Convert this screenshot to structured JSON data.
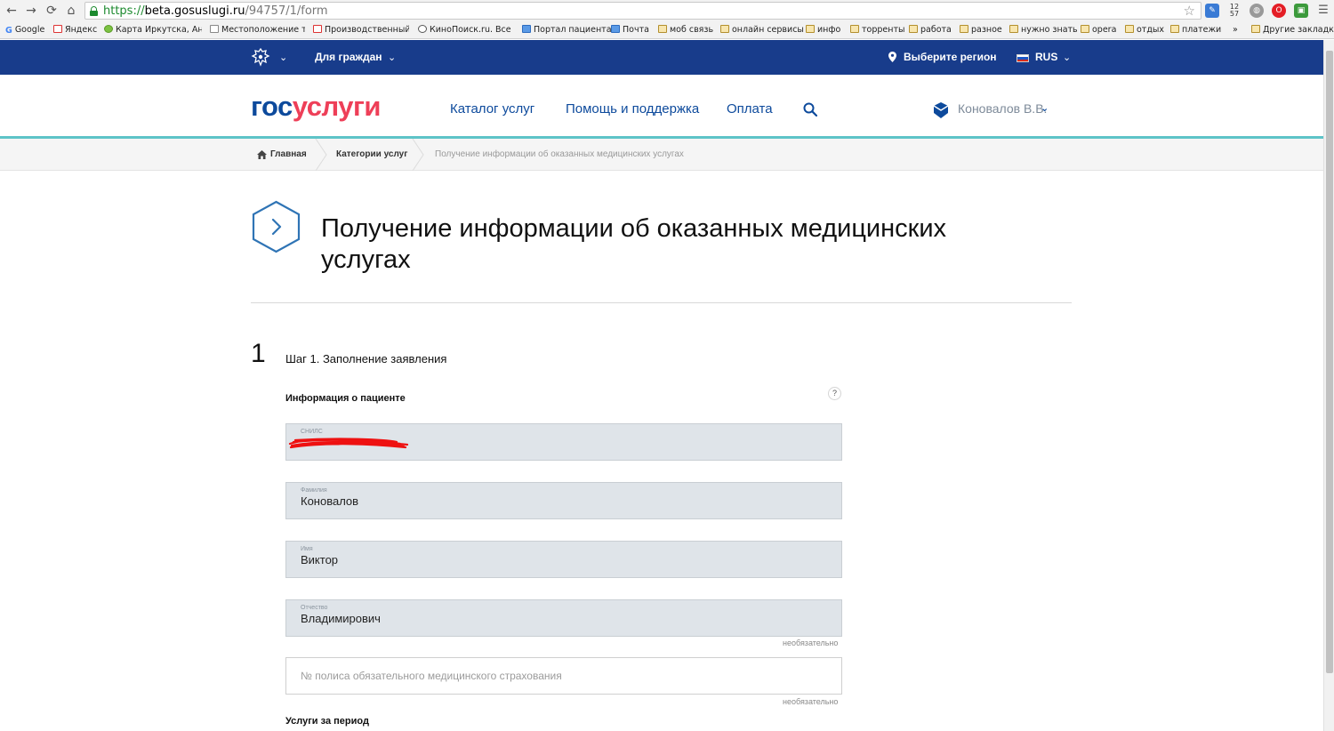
{
  "browser": {
    "url_scheme": "https://",
    "url_host": "beta.gosuslugi.ru",
    "url_path": "/94757/1/form",
    "nav": {
      "back": "←",
      "forward": "→",
      "reload": "⟳",
      "home": "⌂"
    },
    "star": "☆",
    "ext_badge": "12\n57",
    "menu": "☰"
  },
  "bookmarks": [
    {
      "label": "Google",
      "icon": "google-icon"
    },
    {
      "label": "Яндекс",
      "icon": "yandex-icon"
    },
    {
      "label": "Карта Иркутска, Анга",
      "icon": "map-icon"
    },
    {
      "label": "Местоположение тр",
      "icon": "page-icon"
    },
    {
      "label": "Производственный",
      "icon": "page-icon"
    },
    {
      "label": "КиноПоиск.ru. Все ф",
      "icon": "globe-icon"
    },
    {
      "label": "Портал пациента",
      "icon": "page-icon"
    },
    {
      "label": "Почта",
      "icon": "page-icon"
    },
    {
      "label": "моб связь",
      "icon": "folder-icon"
    },
    {
      "label": "онлайн сервисы",
      "icon": "folder-icon"
    },
    {
      "label": "инфо",
      "icon": "folder-icon"
    },
    {
      "label": "торренты",
      "icon": "folder-icon"
    },
    {
      "label": "работа",
      "icon": "folder-icon"
    },
    {
      "label": "разное",
      "icon": "folder-icon"
    },
    {
      "label": "нужно знать",
      "icon": "folder-icon"
    },
    {
      "label": "opera",
      "icon": "folder-icon"
    },
    {
      "label": "отдых",
      "icon": "folder-icon"
    },
    {
      "label": "платежи",
      "icon": "folder-icon"
    },
    {
      "label": "Другие закладки",
      "icon": "folder-icon"
    }
  ],
  "bookmarks_overflow": "»",
  "topbar": {
    "citizens": "Для граждан",
    "region": "Выберите регион",
    "lang": "RUS"
  },
  "header": {
    "logo_gos": "гос",
    "logo_uslugi": "услуги",
    "menu": [
      "Каталог услуг",
      "Помощь и поддержка",
      "Оплата"
    ],
    "user": "Коновалов В.В."
  },
  "breadcrumbs": [
    "Главная",
    "Категории услуг",
    "Получение информации об оказанных медицинских услугах"
  ],
  "page": {
    "title": "Получение информации об оказанных медицинских услугах",
    "step_number": "1",
    "step_title": "Шаг 1. Заполнение заявления",
    "section": "Информация о пациенте",
    "help": "?",
    "fields": {
      "snils": {
        "label": "СНИЛС",
        "value": ""
      },
      "surname": {
        "label": "Фамилия",
        "value": "Коновалов"
      },
      "name": {
        "label": "Имя",
        "value": "Виктор"
      },
      "patronymic": {
        "label": "Отчество",
        "value": "Владимирович"
      },
      "policy": {
        "placeholder": "№ полиса обязательного медицинского страхования",
        "value": ""
      }
    },
    "optional": "необязательно",
    "period": "Услуги за период"
  },
  "colors": {
    "topbar": "#183c8b",
    "brand_blue": "#0d4a9c",
    "brand_red": "#ee3f58",
    "accent_teal": "#5ec4c8",
    "field_bg": "#dfe4e9"
  }
}
